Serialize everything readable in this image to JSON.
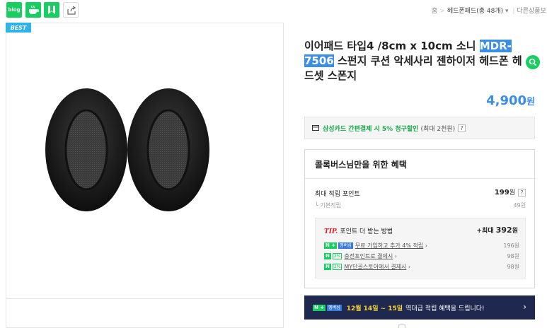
{
  "topbar": {
    "blog_icon_label": "blog",
    "breadcrumb": {
      "home": "홈",
      "category": "헤드폰패드(총 48개)",
      "other": "다른상품보"
    }
  },
  "product": {
    "badge": "BEST",
    "title_before": "이어패드 타입4 /8cm x 10cm 소니 ",
    "title_highlight": "MDR-7506",
    "title_after": " 스펀지 쿠션 악세사리 젠하이저 헤드폰 헤드셋 스폰지",
    "price": "4,900",
    "price_unit": "원"
  },
  "card_discount": {
    "text": "삼성카드 간편결제 시 5% 청구할인",
    "note": "(최대 2천원)",
    "help": "?"
  },
  "benefits": {
    "heading": "콜록버스님만을 위한 혜택",
    "max_points_label": "최대 적립 포인트",
    "max_points_value": "199",
    "max_points_unit": "원",
    "help": "?",
    "basic_label": "기본적립",
    "basic_value": "49원",
    "tip": {
      "tip_word": "TIP.",
      "label": "포인트 더 받는 방법",
      "max_prefix": "+최대",
      "max_value": "392",
      "max_unit": "원",
      "items": [
        {
          "badge": "N +",
          "sub": "멤버십",
          "text": "무료 가입하고 추가 4% 적립",
          "points": "196원"
        },
        {
          "badge": "N",
          "sub": "2%",
          "text": "충전포인트로 결제시",
          "points": "98원"
        },
        {
          "badge": "N",
          "sub": "2%",
          "text": "MY단골스토어에서 결제시",
          "points": "98원"
        }
      ]
    }
  },
  "banner": {
    "badge": "N +",
    "sub": "멤버십",
    "date": "12월 14일 ~ 15일",
    "text": "역대급 적립 혜택을 드립니다!",
    "arrow": "›"
  },
  "colors": {
    "naver_green": "#19ce60",
    "price_blue": "#3a8ee6",
    "banner_navy": "#1f2950",
    "tip_red": "#e01e2b"
  }
}
